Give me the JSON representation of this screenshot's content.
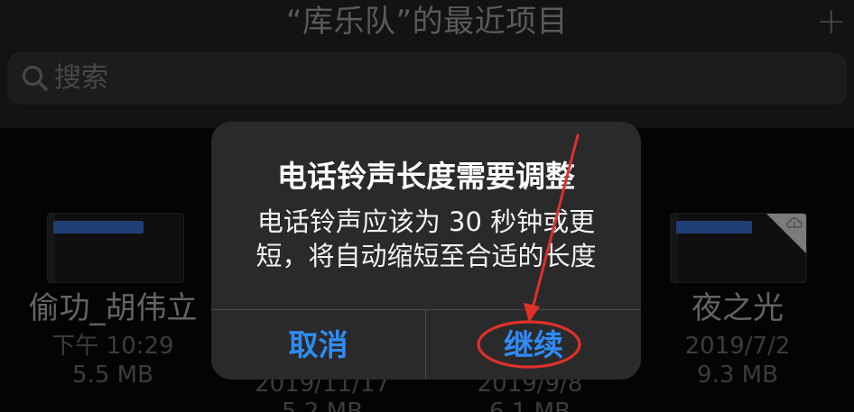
{
  "header": {
    "title": "“库乐队”的最近项目",
    "add_icon": "plus-icon"
  },
  "search": {
    "placeholder": "搜索",
    "icon": "search-icon"
  },
  "files": [
    {
      "name": "偷功_胡伟立",
      "meta1": "下午 10:29",
      "meta2": "5.5 MB"
    },
    {
      "name": "",
      "meta1": "2019/11/17",
      "meta2": "5.2 MB"
    },
    {
      "name": "",
      "meta1": "2019/9/8",
      "meta2": "6.1 MB"
    },
    {
      "name": "夜之光",
      "meta1": "2019/7/2",
      "meta2": "9.3 MB",
      "icon": "cloud-download-icon"
    }
  ],
  "alert": {
    "title": "电话铃声长度需要调整",
    "message": "电话铃声应该为 30 秒钟或更短，将自动缩短至合适的长度",
    "cancel_label": "取消",
    "continue_label": "继续"
  },
  "annotation": {
    "color": "#e0302a"
  }
}
